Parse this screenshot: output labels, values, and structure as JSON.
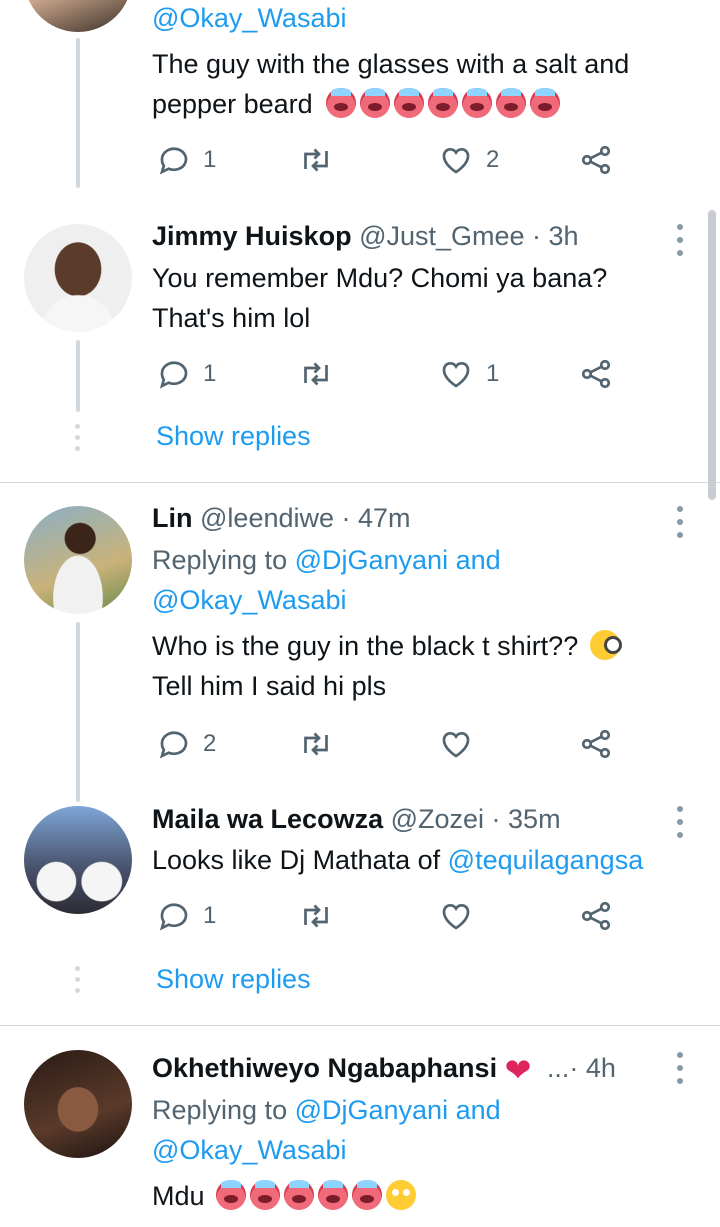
{
  "tweets": [
    {
      "handle_line": "@Okay_Wasabi",
      "text_lines": [
        "The guy with the glasses with a salt and",
        "pepper beard"
      ],
      "emoji": [
        "hot-face",
        "hot-face",
        "hot-face",
        "hot-face",
        "hot-face",
        "hot-face",
        "hot-face"
      ],
      "reply_count": "1",
      "like_count": "2"
    },
    {
      "name": "Jimmy Huiskop",
      "handle_time": "@Just_Gmee · 3h",
      "text_lines": [
        "You remember Mdu? Chomi ya bana?",
        "That's him lol"
      ],
      "reply_count": "1",
      "like_count": "1",
      "show_replies": "Show replies"
    },
    {
      "name": "Lin",
      "handle_time": "@leendiwe · 47m",
      "replying_prefix": "Replying to ",
      "replying_users": "@DjGanyani and",
      "replying_user2": "@Okay_Wasabi",
      "text_lines": [
        "Who is the guy in the black t shirt??",
        "Tell him I said hi pls"
      ],
      "emoji": [
        "face-with-monocle"
      ],
      "reply_count": "2"
    },
    {
      "name": "Maila wa Lecowza",
      "handle_time": "@Zozei · 35m",
      "text_prefix": "Looks like Dj Mathata of ",
      "text_link": "@tequilagangsa",
      "reply_count": "1",
      "show_replies": "Show replies"
    },
    {
      "name": "Okhethiweyo Ngabaphansi",
      "name_emoji": "heart",
      "handle_time": "...· 4h",
      "replying_prefix": "Replying to ",
      "replying_users": "@DjGanyani and",
      "replying_user2": "@Okay_Wasabi",
      "text": "Mdu",
      "emoji": [
        "hot-face",
        "hot-face",
        "hot-face",
        "hot-face",
        "hot-face",
        "face-with-rolling-eyes"
      ]
    }
  ],
  "colors": {
    "link": "#1d9bf0",
    "secondary": "#536471",
    "line": "#cfd9de"
  }
}
